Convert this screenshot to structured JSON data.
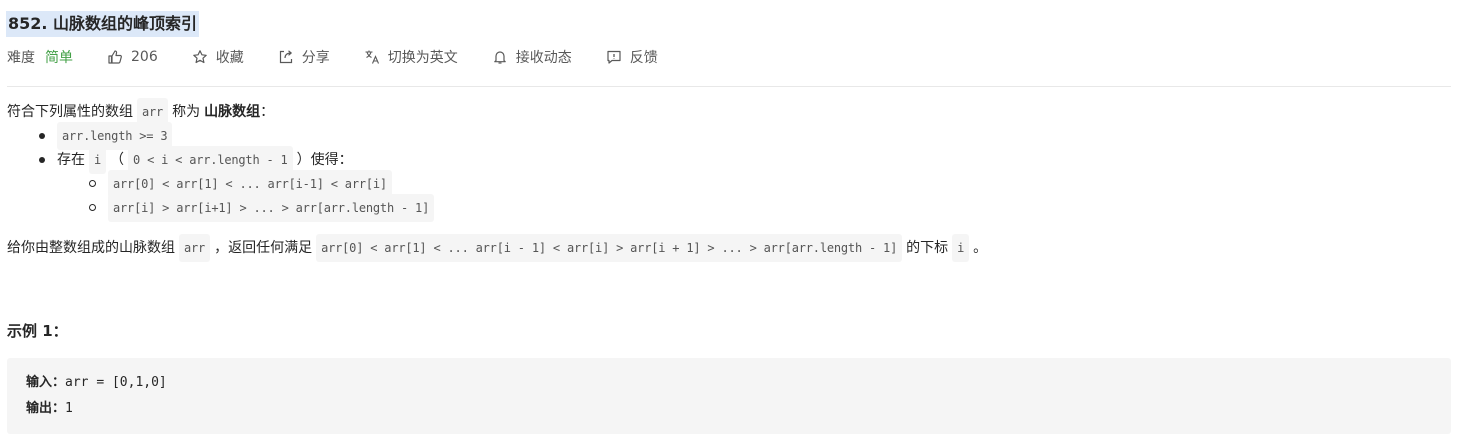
{
  "problem": {
    "title": "852. 山脉数组的峰顶索引"
  },
  "meta": {
    "difficulty_label": "难度",
    "difficulty_value": "简单",
    "likes": "206",
    "collect": "收藏",
    "share": "分享",
    "switch_lang": "切换为英文",
    "notify": "接收动态",
    "feedback": "反馈",
    "icons": [
      "thumbs-up-icon",
      "star-icon",
      "share-icon",
      "translate-icon",
      "bell-icon",
      "feedback-icon"
    ],
    "colors": {
      "easy": "#43a047",
      "highlight": "#dce8f8"
    }
  },
  "description": {
    "intro_pre": "符合下列属性的数组",
    "intro_code": "arr",
    "intro_mid": "称为",
    "intro_bold": "山脉数组",
    "intro_post": "：",
    "cond1_code": "arr.length >= 3",
    "cond2_pre": "存在",
    "cond2_code1": "i",
    "cond2_paren_open": "（",
    "cond2_code2": "0 < i  < arr.length - 1",
    "cond2_paren_close": "）",
    "cond2_post": "使得：",
    "sub1_code": "arr[0] < arr[1] < ... arr[i-1] < arr[i]",
    "sub2_code": "arr[i] > arr[i+1] > ... > arr[arr.length - 1]",
    "task_pre": "给你由整数组成的山脉数组",
    "task_code1": "arr",
    "task_mid": "，返回任何满足",
    "task_code2": "arr[0] < arr[1] < ... arr[i - 1] < arr[i] > arr[i + 1] > ... > arr[arr.length - 1]",
    "task_post": "的下标",
    "task_code3": "i",
    "task_end": "。"
  },
  "example": {
    "title": "示例 1：",
    "input_label": "输入：",
    "input_value": "arr = [0,1,0]",
    "output_label": "输出：",
    "output_value": "1"
  }
}
